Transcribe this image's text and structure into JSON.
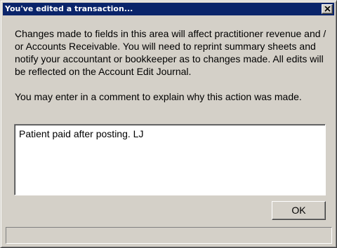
{
  "window": {
    "title": "You've edited a transaction...",
    "close_glyph": "X"
  },
  "message": {
    "paragraph1": "Changes made to fields in this area will affect practitioner revenue and / or Accounts Receivable. You will need to reprint summary sheets and notify your accountant or bookkeeper as to changes made. All edits will be reflected on the Account Edit Journal.",
    "paragraph2": "You may enter in a comment to explain why this action was made."
  },
  "comment": {
    "value": "Patient paid after posting. LJ"
  },
  "buttons": {
    "ok_label": "OK"
  },
  "status_bar": {
    "text": ""
  },
  "colors": {
    "title_bar": "#0a246a",
    "window_face": "#d4d0c8",
    "field_background": "#ffffff"
  }
}
